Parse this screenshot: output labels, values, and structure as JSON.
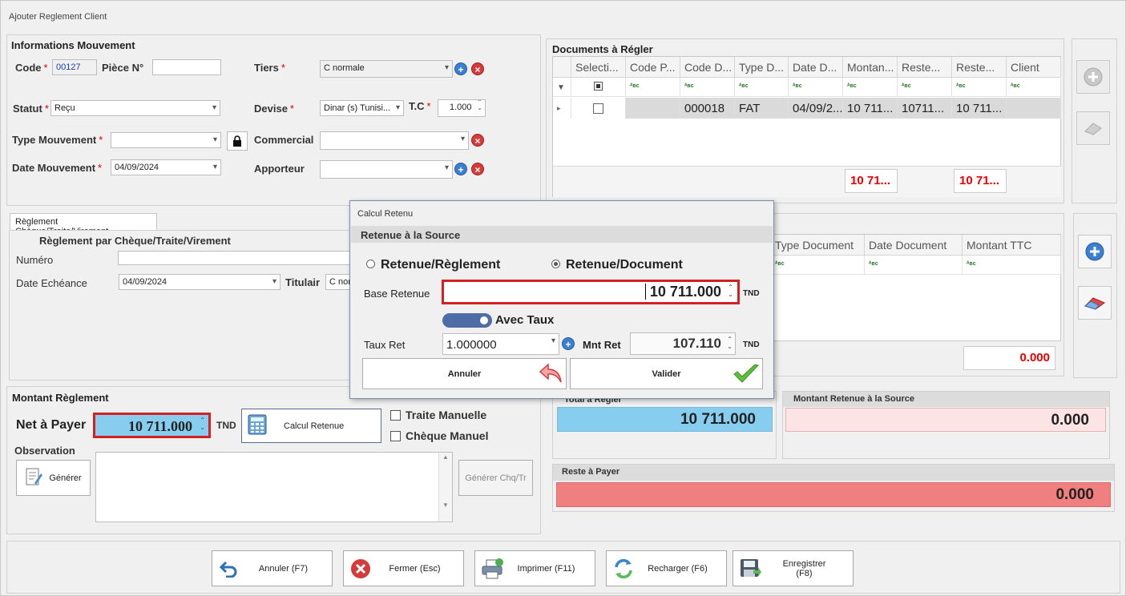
{
  "window": {
    "title": "Ajouter Reglement Client"
  },
  "info": {
    "title": "Informations Mouvement",
    "code_label": "Code",
    "code_value": "00127",
    "piece_label": "Pièce N°",
    "piece_value": "",
    "tiers_label": "Tiers",
    "tiers_value": "C normale",
    "statut_label": "Statut",
    "statut_value": "Reçu",
    "devise_label": "Devise",
    "devise_value": "Dinar (s) Tunisi...",
    "tc_label": "T.C",
    "tc_value": "1.000",
    "type_label": "Type Mouvement",
    "type_value": "",
    "commercial_label": "Commercial",
    "commercial_value": "",
    "date_label": "Date Mouvement",
    "date_value": "04/09/2024",
    "apporteur_label": "Apporteur",
    "apporteur_value": ""
  },
  "reglement": {
    "tab_label": "Règlement Chèque/Traite/Virement",
    "title": "Règlement par Chèque/Traite/Virement",
    "numero_label": "Numéro",
    "numero_value": "",
    "echeance_label": "Date Echéance",
    "echeance_value": "04/09/2024",
    "titulaire_label": "Titulair",
    "titulaire_value": "C norr"
  },
  "montant": {
    "title": "Montant Règlement",
    "net_label": "Net à Payer",
    "net_value": "10 711.000",
    "currency": "TND",
    "calcul_button": "Calcul Retenue",
    "traite_label": "Traite Manuelle",
    "cheque_label": "Chèque Manuel",
    "observation_label": "Observation",
    "generer_button": "Générer",
    "generer_chq_button": "Générer Chq/Tr"
  },
  "documents": {
    "title": "Documents à Régler",
    "columns": [
      "Selecti...",
      "Code P...",
      "Code D...",
      "Type D...",
      "Date D...",
      "Montan...",
      "Reste...",
      "Reste...",
      "Client"
    ],
    "row": [
      "",
      "",
      "000018",
      "FAT",
      "04/09/2...",
      "10 711...",
      "10711...",
      "10 711...",
      ""
    ],
    "total1": "10 71...",
    "total2": "10 71..."
  },
  "documents2": {
    "columns": [
      "Type Document",
      "Date Document",
      "Montant TTC"
    ],
    "total": "0.000"
  },
  "summary": {
    "total_label": "Total à Régler",
    "total_value": "10 711.000",
    "retenue_label": "Montant Retenue à la Source",
    "retenue_value": "0.000",
    "reste_label": "Reste à Payer",
    "reste_value": "0.000"
  },
  "dialog": {
    "title": "Calcul Retenu",
    "section": "Retenue à la Source",
    "radio1": "Retenue/Règlement",
    "radio2": "Retenue/Document",
    "base_label": "Base Retenue",
    "base_value": "10 711.000",
    "base_unit": "TND",
    "toggle_label": "Avec Taux",
    "taux_label": "Taux Ret",
    "taux_value": "1.000000",
    "mnt_label": "Mnt Ret",
    "mnt_value": "107.110",
    "mnt_unit": "TND",
    "annuler": "Annuler",
    "valider": "Valider"
  },
  "footer": {
    "annuler": "Annuler (F7)",
    "fermer": "Fermer (Esc)",
    "imprimer": "Imprimer (F11)",
    "recharger": "Recharger (F6)",
    "enregistrer": "Enregistrer (F8)"
  },
  "colors": {
    "accent": "#3a7fd0",
    "danger": "#d43b3b",
    "highlight_blue": "#87cdf0",
    "reste_red": "#f08080",
    "retenue_pink": "#fde4e4"
  }
}
